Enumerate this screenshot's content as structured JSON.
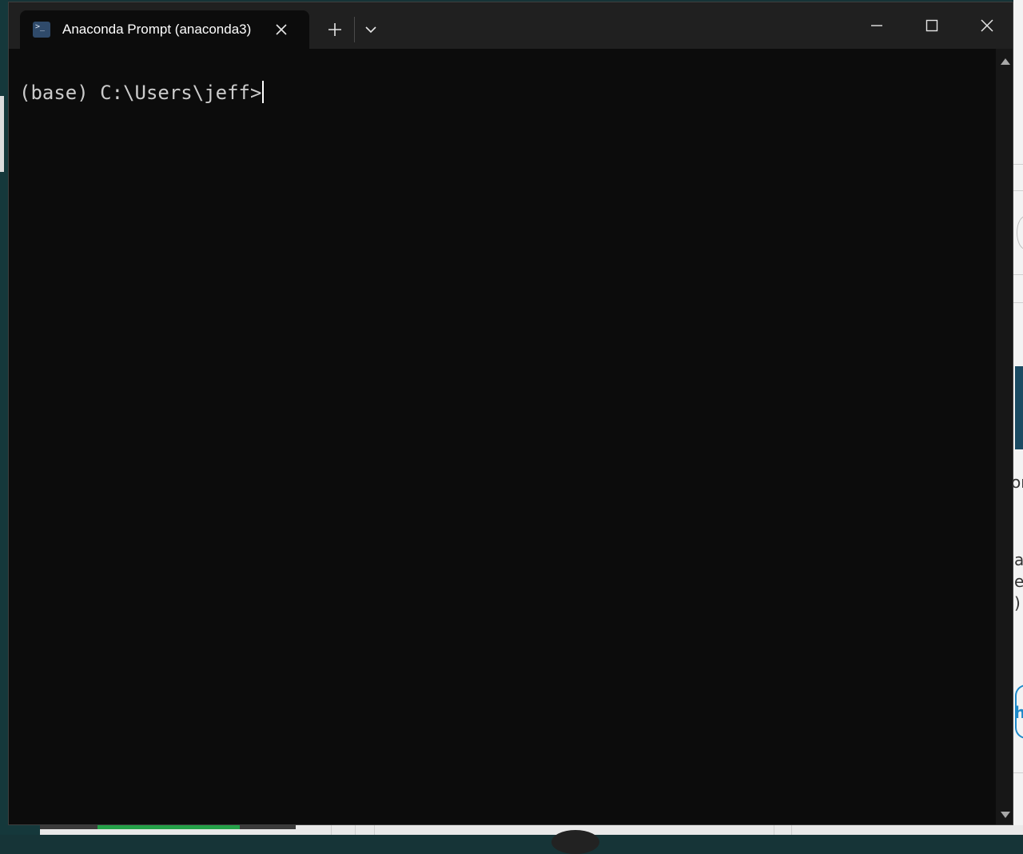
{
  "window": {
    "tab_title": "Anaconda Prompt (anaconda3)",
    "tab_icon": "terminal-icon",
    "new_tab_icon": "plus-icon",
    "dropdown_icon": "chevron-down-icon",
    "controls": [
      "minimize-icon",
      "maximize-icon",
      "close-icon"
    ]
  },
  "terminal": {
    "prompt_text": "(base) C:\\Users\\jeff>",
    "background_color": "#0c0c0c",
    "text_color": "#cccccc"
  },
  "background_fragments": {
    "frag_1": "or",
    "frag_2": "a",
    "frag_3": "e",
    "frag_4": ")",
    "frag_5": "h"
  }
}
